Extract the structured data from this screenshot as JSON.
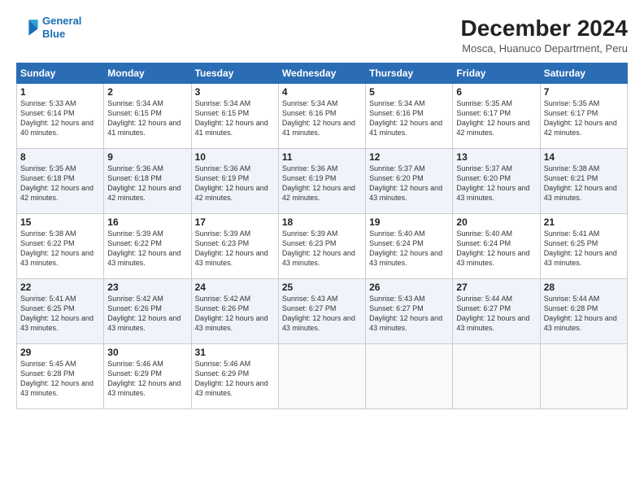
{
  "logo": {
    "line1": "General",
    "line2": "Blue"
  },
  "header": {
    "title": "December 2024",
    "subtitle": "Mosca, Huanuco Department, Peru"
  },
  "weekdays": [
    "Sunday",
    "Monday",
    "Tuesday",
    "Wednesday",
    "Thursday",
    "Friday",
    "Saturday"
  ],
  "weeks": [
    [
      {
        "day": "1",
        "sunrise": "5:33 AM",
        "sunset": "6:14 PM",
        "daylight": "12 hours and 40 minutes."
      },
      {
        "day": "2",
        "sunrise": "5:34 AM",
        "sunset": "6:15 PM",
        "daylight": "12 hours and 41 minutes."
      },
      {
        "day": "3",
        "sunrise": "5:34 AM",
        "sunset": "6:15 PM",
        "daylight": "12 hours and 41 minutes."
      },
      {
        "day": "4",
        "sunrise": "5:34 AM",
        "sunset": "6:16 PM",
        "daylight": "12 hours and 41 minutes."
      },
      {
        "day": "5",
        "sunrise": "5:34 AM",
        "sunset": "6:16 PM",
        "daylight": "12 hours and 41 minutes."
      },
      {
        "day": "6",
        "sunrise": "5:35 AM",
        "sunset": "6:17 PM",
        "daylight": "12 hours and 42 minutes."
      },
      {
        "day": "7",
        "sunrise": "5:35 AM",
        "sunset": "6:17 PM",
        "daylight": "12 hours and 42 minutes."
      }
    ],
    [
      {
        "day": "8",
        "sunrise": "5:35 AM",
        "sunset": "6:18 PM",
        "daylight": "12 hours and 42 minutes."
      },
      {
        "day": "9",
        "sunrise": "5:36 AM",
        "sunset": "6:18 PM",
        "daylight": "12 hours and 42 minutes."
      },
      {
        "day": "10",
        "sunrise": "5:36 AM",
        "sunset": "6:19 PM",
        "daylight": "12 hours and 42 minutes."
      },
      {
        "day": "11",
        "sunrise": "5:36 AM",
        "sunset": "6:19 PM",
        "daylight": "12 hours and 42 minutes."
      },
      {
        "day": "12",
        "sunrise": "5:37 AM",
        "sunset": "6:20 PM",
        "daylight": "12 hours and 43 minutes."
      },
      {
        "day": "13",
        "sunrise": "5:37 AM",
        "sunset": "6:20 PM",
        "daylight": "12 hours and 43 minutes."
      },
      {
        "day": "14",
        "sunrise": "5:38 AM",
        "sunset": "6:21 PM",
        "daylight": "12 hours and 43 minutes."
      }
    ],
    [
      {
        "day": "15",
        "sunrise": "5:38 AM",
        "sunset": "6:22 PM",
        "daylight": "12 hours and 43 minutes."
      },
      {
        "day": "16",
        "sunrise": "5:39 AM",
        "sunset": "6:22 PM",
        "daylight": "12 hours and 43 minutes."
      },
      {
        "day": "17",
        "sunrise": "5:39 AM",
        "sunset": "6:23 PM",
        "daylight": "12 hours and 43 minutes."
      },
      {
        "day": "18",
        "sunrise": "5:39 AM",
        "sunset": "6:23 PM",
        "daylight": "12 hours and 43 minutes."
      },
      {
        "day": "19",
        "sunrise": "5:40 AM",
        "sunset": "6:24 PM",
        "daylight": "12 hours and 43 minutes."
      },
      {
        "day": "20",
        "sunrise": "5:40 AM",
        "sunset": "6:24 PM",
        "daylight": "12 hours and 43 minutes."
      },
      {
        "day": "21",
        "sunrise": "5:41 AM",
        "sunset": "6:25 PM",
        "daylight": "12 hours and 43 minutes."
      }
    ],
    [
      {
        "day": "22",
        "sunrise": "5:41 AM",
        "sunset": "6:25 PM",
        "daylight": "12 hours and 43 minutes."
      },
      {
        "day": "23",
        "sunrise": "5:42 AM",
        "sunset": "6:26 PM",
        "daylight": "12 hours and 43 minutes."
      },
      {
        "day": "24",
        "sunrise": "5:42 AM",
        "sunset": "6:26 PM",
        "daylight": "12 hours and 43 minutes."
      },
      {
        "day": "25",
        "sunrise": "5:43 AM",
        "sunset": "6:27 PM",
        "daylight": "12 hours and 43 minutes."
      },
      {
        "day": "26",
        "sunrise": "5:43 AM",
        "sunset": "6:27 PM",
        "daylight": "12 hours and 43 minutes."
      },
      {
        "day": "27",
        "sunrise": "5:44 AM",
        "sunset": "6:27 PM",
        "daylight": "12 hours and 43 minutes."
      },
      {
        "day": "28",
        "sunrise": "5:44 AM",
        "sunset": "6:28 PM",
        "daylight": "12 hours and 43 minutes."
      }
    ],
    [
      {
        "day": "29",
        "sunrise": "5:45 AM",
        "sunset": "6:28 PM",
        "daylight": "12 hours and 43 minutes."
      },
      {
        "day": "30",
        "sunrise": "5:46 AM",
        "sunset": "6:29 PM",
        "daylight": "12 hours and 43 minutes."
      },
      {
        "day": "31",
        "sunrise": "5:46 AM",
        "sunset": "6:29 PM",
        "daylight": "12 hours and 43 minutes."
      },
      null,
      null,
      null,
      null
    ]
  ]
}
